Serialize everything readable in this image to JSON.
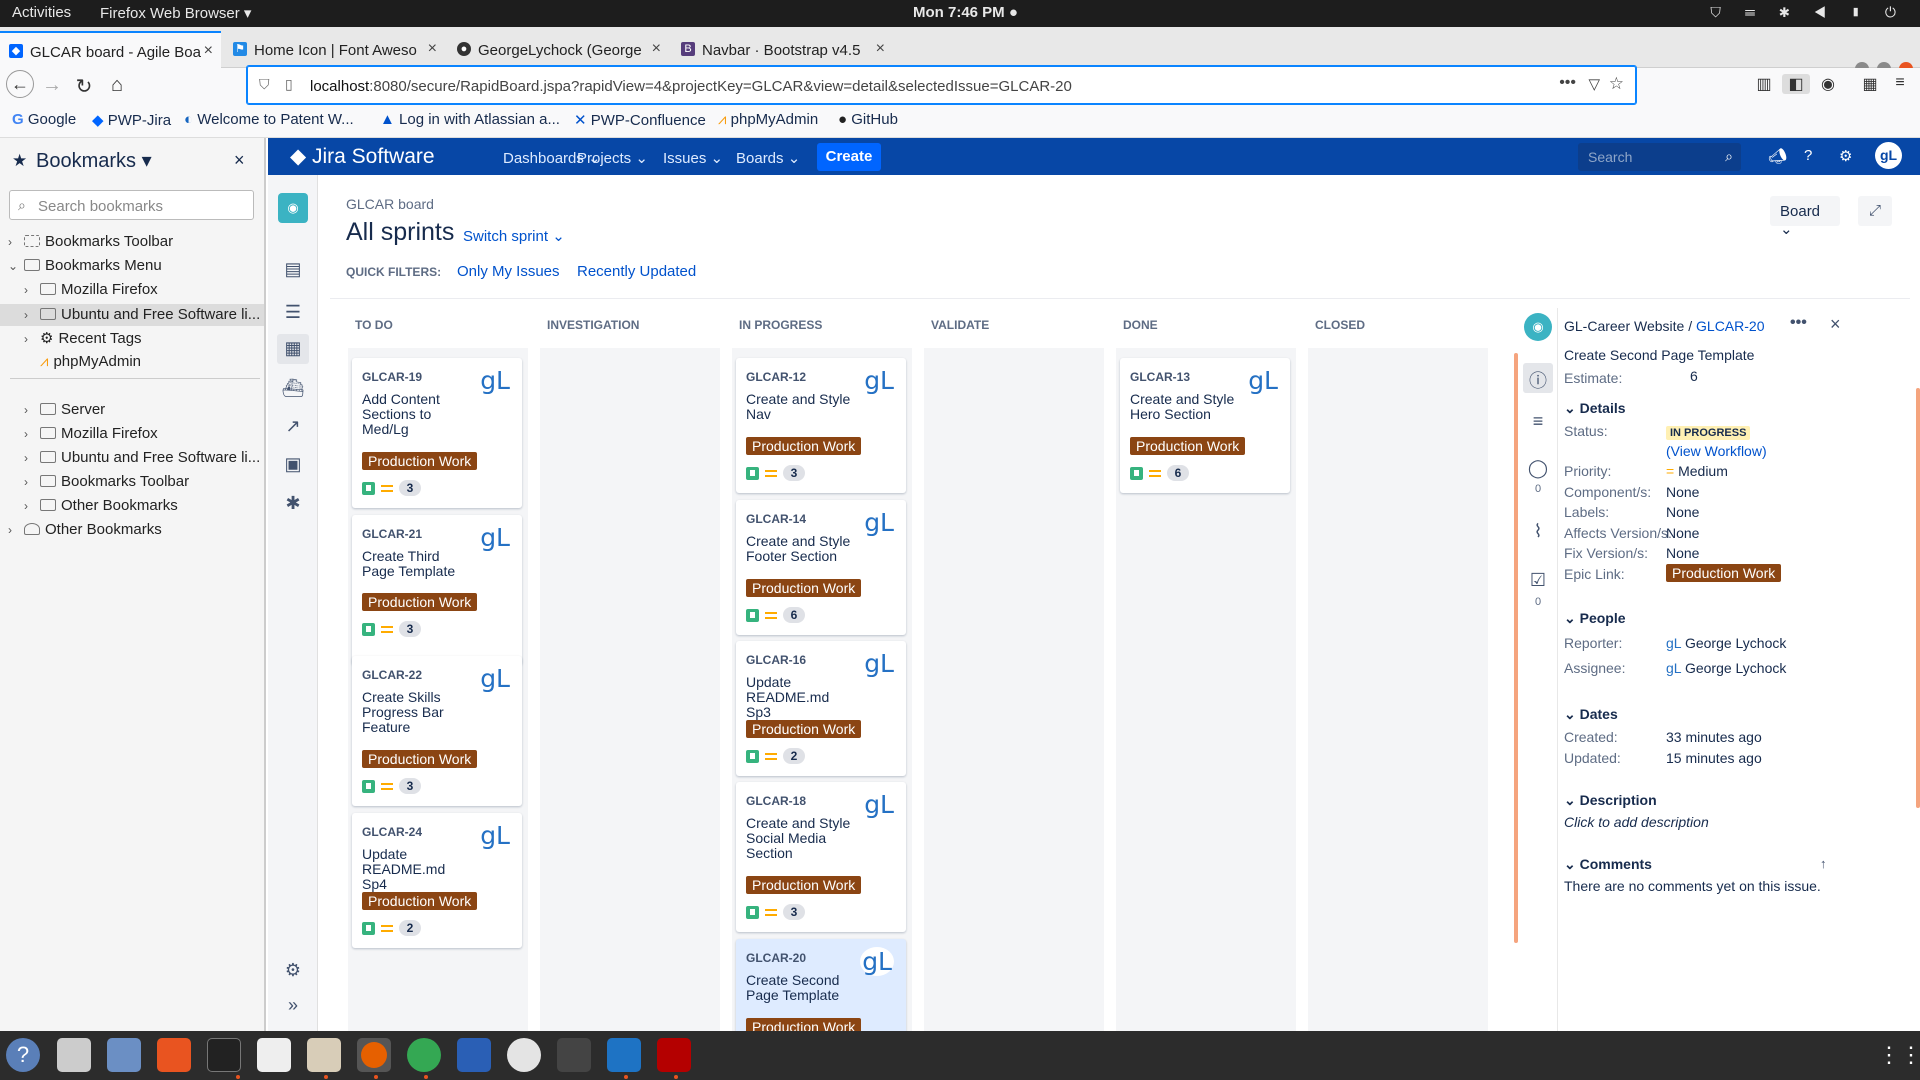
{
  "topbar": {
    "activities": "Activities",
    "app": "Firefox Web Browser ▾",
    "clock": "Mon  7:46 PM ●"
  },
  "tabs": [
    {
      "label": "GLCAR board - Agile Boa",
      "active": true
    },
    {
      "label": "Home Icon | Font Aweso",
      "active": false
    },
    {
      "label": "GeorgeLychock (George",
      "active": false
    },
    {
      "label": "Navbar · Bootstrap v4.5",
      "active": false
    }
  ],
  "url": {
    "host": "localhost",
    "rest": ":8080/secure/RapidBoard.jspa?rapidView=4&projectKey=GLCAR&view=detail&selectedIssue=GLCAR-20"
  },
  "bookmarks_bar": [
    "Google",
    "PWP-Jira",
    "Welcome to Patent W...",
    "Log in with Atlassian a...",
    "PWP-Confluence",
    "phpMyAdmin",
    "GitHub"
  ],
  "sidebar": {
    "title": "Bookmarks ▾",
    "search_placeholder": "Search bookmarks",
    "items": [
      "Bookmarks Toolbar",
      "Bookmarks Menu",
      "Mozilla Firefox",
      "Ubuntu and Free Software li...",
      "Recent Tags",
      "phpMyAdmin",
      "Server",
      "Mozilla Firefox",
      "Ubuntu and Free Software li...",
      "Bookmarks Toolbar",
      "Other Bookmarks",
      "Other Bookmarks"
    ]
  },
  "jira": {
    "logo": "Jira Software",
    "menu": [
      "Dashboards",
      "Projects",
      "Issues",
      "Boards"
    ],
    "create": "Create",
    "search_placeholder": "Search",
    "avatar": "gL"
  },
  "board": {
    "crumb": "GLCAR board",
    "title": "All sprints",
    "switch": "Switch sprint",
    "quick_filters_label": "QUICK FILTERS:",
    "quick_filters": [
      "Only My Issues",
      "Recently Updated"
    ],
    "view_button": "Board",
    "columns": [
      "TO DO",
      "INVESTIGATION",
      "IN PROGRESS",
      "VALIDATE",
      "DONE",
      "CLOSED"
    ]
  },
  "epic_label": "Production Work",
  "cards": {
    "c19": {
      "key": "GLCAR-19",
      "summary": "Add Content Sections to Med/Lg",
      "est": "3"
    },
    "c21": {
      "key": "GLCAR-21",
      "summary": "Create Third Page Template",
      "est": "3"
    },
    "c22": {
      "key": "GLCAR-22",
      "summary": "Create Skills Progress Bar Feature",
      "est": "3"
    },
    "c24": {
      "key": "GLCAR-24",
      "summary": "Update README.md Sp4",
      "est": "2"
    },
    "c12": {
      "key": "GLCAR-12",
      "summary": "Create and Style Nav",
      "est": "3"
    },
    "c14": {
      "key": "GLCAR-14",
      "summary": "Create and Style Footer Section",
      "est": "6"
    },
    "c16": {
      "key": "GLCAR-16",
      "summary": "Update README.md Sp3",
      "est": "2"
    },
    "c18": {
      "key": "GLCAR-18",
      "summary": "Create and Style Social Media Section",
      "est": "3"
    },
    "c20": {
      "key": "GLCAR-20",
      "summary": "Create Second Page Template",
      "est": ""
    },
    "c13": {
      "key": "GLCAR-13",
      "summary": "Create and Style Hero Section",
      "est": "6"
    }
  },
  "card_avatar": "gL",
  "detail": {
    "project": "GL-Career Website",
    "sep": "/",
    "issue_key": "GLCAR-20",
    "summary": "Create Second Page Template",
    "estimate_label": "Estimate:",
    "estimate": "6",
    "details_heading": "Details",
    "status_label": "Status:",
    "status": "IN PROGRESS",
    "view_workflow": "(View Workflow)",
    "priority_label": "Priority:",
    "priority": "Medium",
    "components_label": "Component/s:",
    "components": "None",
    "labels_label": "Labels:",
    "labels": "None",
    "affects_label": "Affects Version/s:",
    "affects": "None",
    "fix_label": "Fix Version/s:",
    "fix": "None",
    "epic_label": "Epic Link:",
    "epic": "Production Work",
    "people_heading": "People",
    "reporter_label": "Reporter:",
    "reporter": "George Lychock",
    "assignee_label": "Assignee:",
    "assignee": "George Lychock",
    "dates_heading": "Dates",
    "created_label": "Created:",
    "created": "33 minutes ago",
    "updated_label": "Updated:",
    "updated": "15 minutes ago",
    "description_heading": "Description",
    "description_placeholder": "Click to add description",
    "comments_heading": "Comments",
    "comments_empty": "There are no comments yet on this issue.",
    "comment_count": "0",
    "subtask_count": "0"
  }
}
